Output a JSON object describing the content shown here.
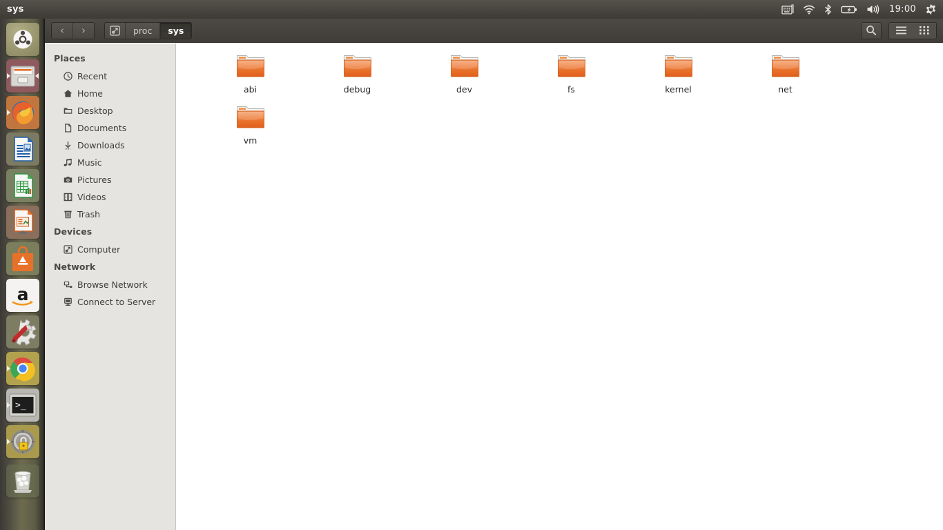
{
  "panel": {
    "title": "sys",
    "clock": "19:00",
    "tray_icons": [
      "keyboard-icon",
      "wifi-icon",
      "bluetooth-icon",
      "battery-icon",
      "volume-icon",
      "power-gear-icon"
    ]
  },
  "launcher": {
    "items": [
      {
        "name": "ubuntu-dash",
        "label": "Dash home",
        "running": false,
        "focused": false
      },
      {
        "name": "files-nautilus",
        "label": "Files",
        "running": true,
        "focused": true
      },
      {
        "name": "firefox",
        "label": "Firefox Web Browser",
        "running": true,
        "focused": false
      },
      {
        "name": "libreoffice-writer",
        "label": "LibreOffice Writer",
        "running": false,
        "focused": false
      },
      {
        "name": "libreoffice-calc",
        "label": "LibreOffice Calc",
        "running": false,
        "focused": false
      },
      {
        "name": "libreoffice-impress",
        "label": "LibreOffice Impress",
        "running": false,
        "focused": false
      },
      {
        "name": "ubuntu-software",
        "label": "Ubuntu Software",
        "running": false,
        "focused": false
      },
      {
        "name": "amazon",
        "label": "Amazon",
        "running": false,
        "focused": false
      },
      {
        "name": "system-settings",
        "label": "System Settings",
        "running": false,
        "focused": false
      },
      {
        "name": "google-chrome",
        "label": "Google Chrome",
        "running": true,
        "focused": false
      },
      {
        "name": "terminal",
        "label": "Terminal",
        "running": true,
        "focused": false
      },
      {
        "name": "keyring-lock",
        "label": "Passwords and Keys",
        "running": true,
        "focused": false
      },
      {
        "name": "trash",
        "label": "Trash",
        "running": false,
        "focused": false
      }
    ]
  },
  "toolbar": {
    "back_label": "‹",
    "forward_label": "›",
    "breadcrumbs": [
      {
        "label": "proc",
        "active": false
      },
      {
        "label": "sys",
        "active": true
      }
    ],
    "search_icon": "search-icon",
    "list_view_icon": "list-view-icon",
    "grid_view_icon": "grid-view-icon",
    "active_view": "grid"
  },
  "sidebar": {
    "sections": [
      {
        "heading": "Places",
        "items": [
          {
            "label": "Recent",
            "icon": "clock-icon"
          },
          {
            "label": "Home",
            "icon": "home-icon"
          },
          {
            "label": "Desktop",
            "icon": "folder-icon"
          },
          {
            "label": "Documents",
            "icon": "document-icon"
          },
          {
            "label": "Downloads",
            "icon": "download-icon"
          },
          {
            "label": "Music",
            "icon": "music-icon"
          },
          {
            "label": "Pictures",
            "icon": "camera-icon"
          },
          {
            "label": "Videos",
            "icon": "film-icon"
          },
          {
            "label": "Trash",
            "icon": "trash-icon"
          }
        ]
      },
      {
        "heading": "Devices",
        "items": [
          {
            "label": "Computer",
            "icon": "computer-icon"
          }
        ]
      },
      {
        "heading": "Network",
        "items": [
          {
            "label": "Browse Network",
            "icon": "network-icon"
          },
          {
            "label": "Connect to Server",
            "icon": "server-icon"
          }
        ]
      }
    ]
  },
  "content": {
    "items": [
      {
        "label": "abi",
        "icon": "folder-icon"
      },
      {
        "label": "debug",
        "icon": "folder-icon"
      },
      {
        "label": "dev",
        "icon": "folder-icon"
      },
      {
        "label": "fs",
        "icon": "folder-icon"
      },
      {
        "label": "kernel",
        "icon": "folder-icon"
      },
      {
        "label": "net",
        "icon": "folder-icon"
      },
      {
        "label": "vm",
        "icon": "folder-icon"
      }
    ]
  },
  "colors": {
    "panel_bg": "#4a4741",
    "toolbar_bg": "#46433e",
    "sidebar_bg": "#e6e4e1",
    "content_bg": "#ffffff",
    "folder_orange": "#e8712a",
    "text_dark": "#3f3d3a"
  }
}
